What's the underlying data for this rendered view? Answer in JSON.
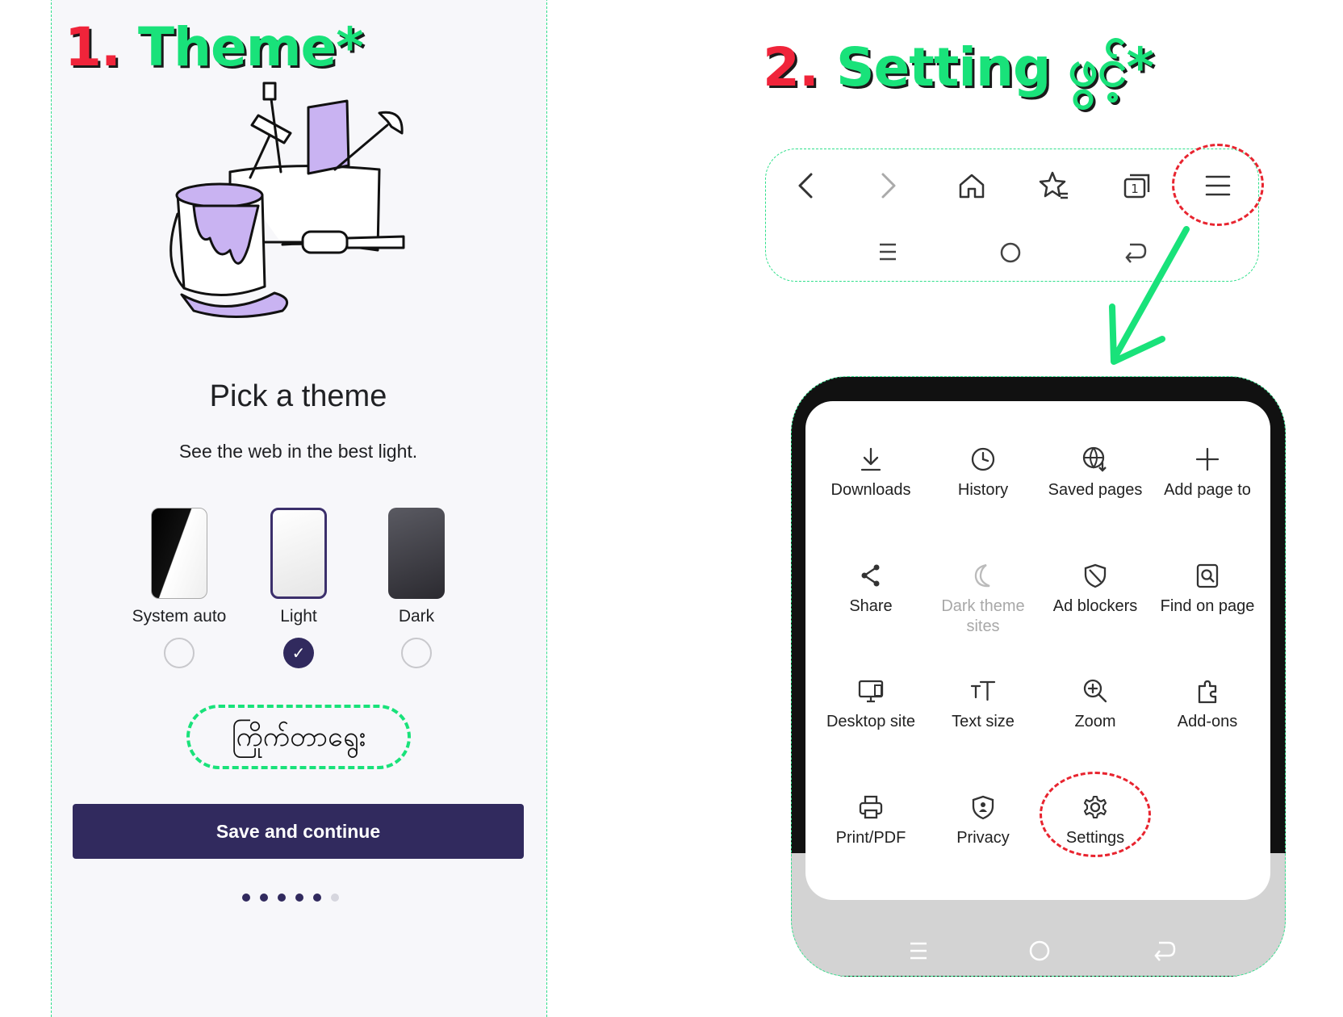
{
  "step1": {
    "num": "1.",
    "title": "Theme*"
  },
  "step2": {
    "num": "2.",
    "title": "Setting ဖွင့်*"
  },
  "onboarding": {
    "heading": "Pick a theme",
    "subheading": "See the web in the best light.",
    "themes": [
      {
        "label": "System auto",
        "selected": false
      },
      {
        "label": "Light",
        "selected": true
      },
      {
        "label": "Dark",
        "selected": false
      }
    ],
    "choose_hint": "ကြိုက်တာရွေး",
    "save_button": "Save and continue",
    "pager": {
      "total": 6,
      "current": 5
    }
  },
  "toolbar": {
    "icons": [
      "back-icon",
      "forward-icon",
      "home-icon",
      "bookmarks-icon",
      "tabs-icon",
      "menu-icon"
    ],
    "tab_count": "1",
    "system_nav": [
      "recents-icon",
      "home-circle-icon",
      "back-nav-icon"
    ]
  },
  "menu": {
    "items": [
      {
        "label": "Downloads",
        "icon": "download-icon"
      },
      {
        "label": "History",
        "icon": "clock-icon"
      },
      {
        "label": "Saved pages",
        "icon": "globe-download-icon"
      },
      {
        "label": "Add page to",
        "icon": "plus-icon"
      },
      {
        "label": "Share",
        "icon": "share-icon"
      },
      {
        "label": "Dark theme sites",
        "icon": "moon-icon",
        "disabled": true
      },
      {
        "label": "Ad blockers",
        "icon": "shield-block-icon"
      },
      {
        "label": "Find on page",
        "icon": "find-icon"
      },
      {
        "label": "Desktop site",
        "icon": "monitor-icon"
      },
      {
        "label": "Text size",
        "icon": "text-size-icon"
      },
      {
        "label": "Zoom",
        "icon": "zoom-icon"
      },
      {
        "label": "Add-ons",
        "icon": "puzzle-icon"
      },
      {
        "label": "Print/PDF",
        "icon": "printer-icon"
      },
      {
        "label": "Privacy",
        "icon": "privacy-shield-icon"
      },
      {
        "label": "Settings",
        "icon": "gear-icon"
      }
    ]
  },
  "colors": {
    "accent": "#312a5e",
    "annotation_green": "#19e27a",
    "annotation_red": "#e8242f"
  }
}
